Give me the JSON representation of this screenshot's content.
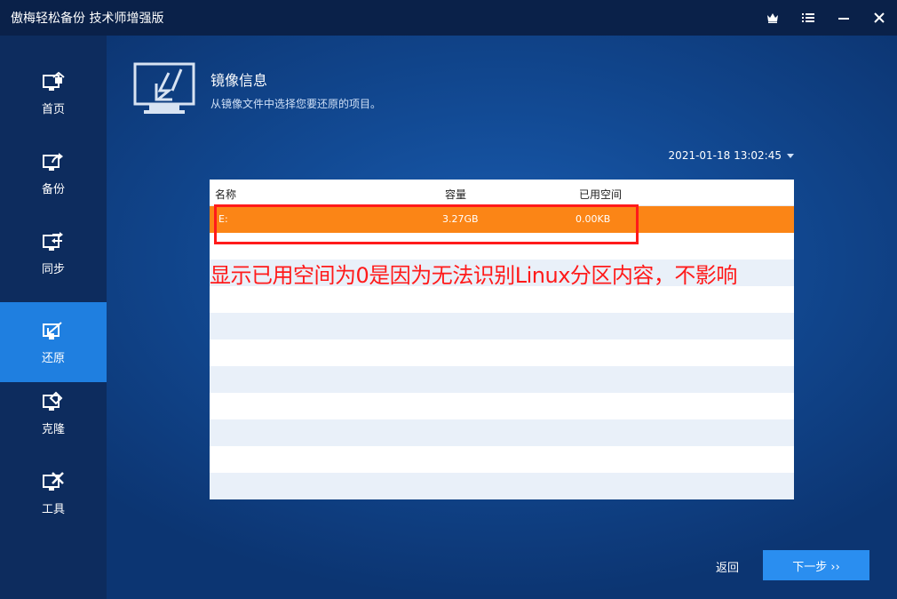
{
  "window": {
    "title": "傲梅轻松备份 技术师增强版",
    "controls": [
      "crown-icon",
      "menu-icon",
      "minimize-icon",
      "close-icon"
    ]
  },
  "sidebar": {
    "items": [
      {
        "label": "首页",
        "icon": "home-icon",
        "active": false
      },
      {
        "label": "备份",
        "icon": "backup-icon",
        "active": false
      },
      {
        "label": "同步",
        "icon": "sync-icon",
        "active": false
      },
      {
        "label": "还原",
        "icon": "restore-icon",
        "active": true
      },
      {
        "label": "克隆",
        "icon": "clone-icon",
        "active": false
      },
      {
        "label": "工具",
        "icon": "tools-icon",
        "active": false
      }
    ]
  },
  "header": {
    "title": "镜像信息",
    "subtitle": "从镜像文件中选择您要还原的项目。"
  },
  "backup_point": {
    "selected": "2021-01-18 13:02:45"
  },
  "table": {
    "columns": [
      "名称",
      "容量",
      "已用空间"
    ],
    "rows": [
      {
        "name": "E:",
        "capacity": "3.27GB",
        "used": "0.00KB",
        "selected": true
      }
    ]
  },
  "annotation": {
    "text": "显示已用空间为0是因为无法识别Linux分区内容，不影响"
  },
  "footer": {
    "back_label": "返回",
    "next_label": "下一步 ››"
  },
  "colors": {
    "accent": "#1f7fe0",
    "selected_row": "#fb8516",
    "annotation": "#ff1a1a",
    "button": "#2a8ef0"
  }
}
